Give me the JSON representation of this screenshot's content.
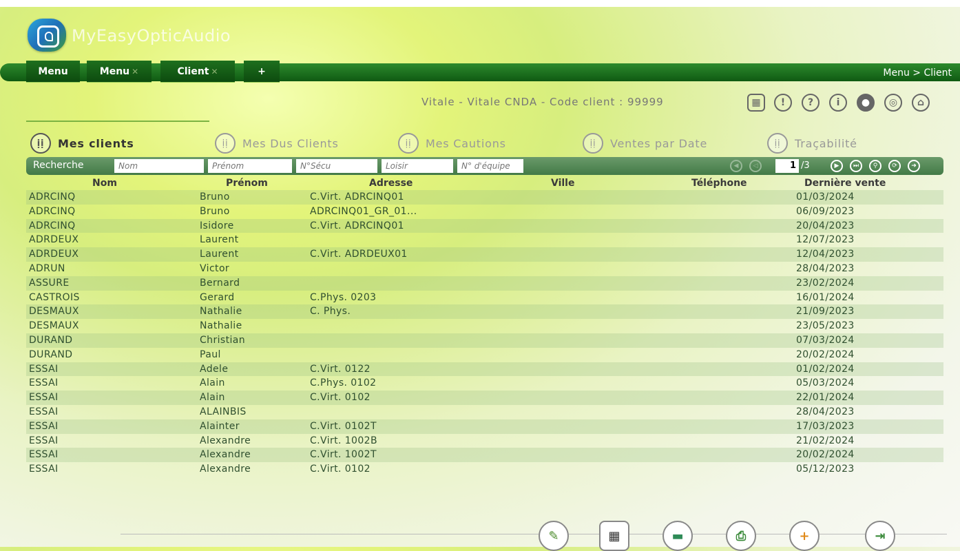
{
  "app": {
    "title": "MyEasyOpticAudio"
  },
  "nav": {
    "tabs": [
      {
        "label": "Menu"
      },
      {
        "label": "Menu"
      },
      {
        "label": "Client"
      },
      {
        "label": "+"
      }
    ],
    "breadcrumb": "Menu > Client"
  },
  "client_info": "Vitale - Vitale CNDA - Code client : 99999",
  "subtabs": [
    {
      "label": "Mes clients"
    },
    {
      "label": "Mes Dus Clients"
    },
    {
      "label": "Mes Cautions"
    },
    {
      "label": "Ventes par Date"
    },
    {
      "label": "Traçabilité"
    }
  ],
  "search": {
    "label": "Recherche",
    "placeholders": {
      "nom": "Nom",
      "prenom": "Prénom",
      "secu": "N°Sécu",
      "loisir": "Loisir",
      "equipement": "N° d'équipe"
    },
    "page": "1",
    "total": "/3"
  },
  "table": {
    "headers": {
      "nom": "Nom",
      "prenom": "Prénom",
      "adresse": "Adresse",
      "ville": "Ville",
      "telephone": "Téléphone",
      "derniere": "Dernière vente"
    },
    "rows": [
      {
        "nom": "ADRCINQ",
        "prenom": "Bruno",
        "adresse": "C.Virt. ADRCINQ01",
        "date": "01/03/2024"
      },
      {
        "nom": "ADRCINQ",
        "prenom": "Bruno",
        "adresse": "ADRCINQ01_GR_01...",
        "date": "06/09/2023"
      },
      {
        "nom": "ADRCINQ",
        "prenom": "Isidore",
        "adresse": "C.Virt. ADRCINQ01",
        "date": "20/04/2023"
      },
      {
        "nom": "ADRDEUX",
        "prenom": "Laurent",
        "adresse": "",
        "date": "12/07/2023"
      },
      {
        "nom": "ADRDEUX",
        "prenom": "Laurent",
        "adresse": "C.Virt. ADRDEUX01",
        "date": "12/04/2023"
      },
      {
        "nom": "ADRUN",
        "prenom": "Victor",
        "adresse": "",
        "date": "28/04/2023"
      },
      {
        "nom": "ASSURE",
        "prenom": "Bernard",
        "adresse": "",
        "date": "23/02/2024"
      },
      {
        "nom": "CASTROIS",
        "prenom": "Gerard",
        "adresse": "C.Phys. 0203",
        "date": "16/01/2024"
      },
      {
        "nom": "DESMAUX",
        "prenom": "Nathalie",
        "adresse": "C. Phys.",
        "date": "21/09/2023"
      },
      {
        "nom": "DESMAUX",
        "prenom": "Nathalie",
        "adresse": "",
        "date": "23/05/2023"
      },
      {
        "nom": "DURAND",
        "prenom": "Christian",
        "adresse": "",
        "date": "07/03/2024"
      },
      {
        "nom": "DURAND",
        "prenom": "Paul",
        "adresse": "",
        "date": "20/02/2024"
      },
      {
        "nom": "ESSAI",
        "prenom": "Adele",
        "adresse": "C.Virt. 0122",
        "date": "01/02/2024"
      },
      {
        "nom": "ESSAI",
        "prenom": "Alain",
        "adresse": "C.Phys. 0102",
        "date": "05/03/2024"
      },
      {
        "nom": "ESSAI",
        "prenom": "Alain",
        "adresse": "C.Virt. 0102",
        "date": "22/01/2024"
      },
      {
        "nom": "ESSAI",
        "prenom": "ALAINBIS",
        "adresse": "",
        "date": "28/04/2023"
      },
      {
        "nom": "ESSAI",
        "prenom": "Alainter",
        "adresse": "C.Virt. 0102T",
        "date": "17/03/2023"
      },
      {
        "nom": "ESSAI",
        "prenom": "Alexandre",
        "adresse": "C.Virt. 1002B",
        "date": "21/02/2024"
      },
      {
        "nom": "ESSAI",
        "prenom": "Alexandre",
        "adresse": "C.Virt. 1002T",
        "date": "20/02/2024"
      },
      {
        "nom": "ESSAI",
        "prenom": "Alexandre",
        "adresse": "C.Virt. 0102",
        "date": "05/12/2023"
      }
    ]
  },
  "icons": {
    "top": [
      "calendar-icon",
      "warning-icon",
      "help-icon",
      "info-icon",
      "user-icon",
      "hearing-icon",
      "home-icon"
    ],
    "bottom": [
      "edit-icon",
      "qr-code-icon",
      "vitale-card-icon",
      "print-icon",
      "add-user-icon",
      "exit-icon"
    ]
  },
  "colors": {
    "nav": "#1e6f1e",
    "searchbar": "#5a8a5c",
    "accent": "#7cb342"
  }
}
